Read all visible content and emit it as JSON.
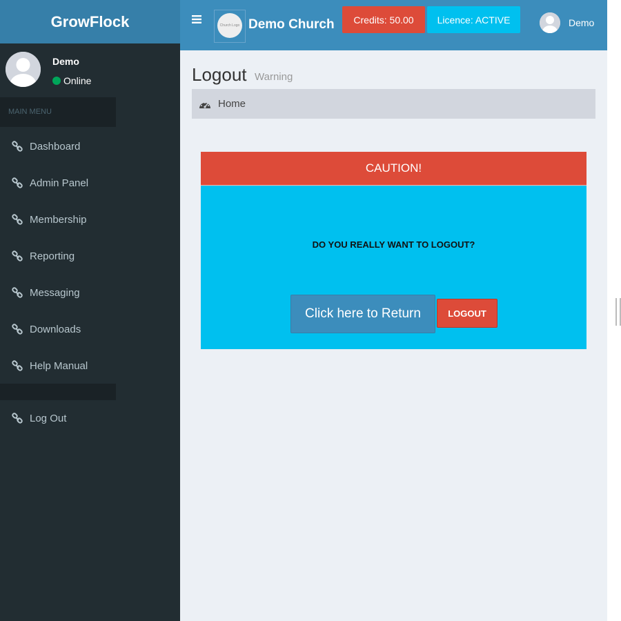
{
  "brand": {
    "name": "GrowFlock"
  },
  "user_panel": {
    "name": "Demo",
    "status": "Online",
    "status_color": "#00a65a"
  },
  "sidebar": {
    "header": "MAIN MENU",
    "items": [
      {
        "label": "Dashboard",
        "icon": "link-icon"
      },
      {
        "label": "Admin Panel",
        "icon": "link-icon"
      },
      {
        "label": "Membership",
        "icon": "link-icon"
      },
      {
        "label": "Reporting",
        "icon": "link-icon"
      },
      {
        "label": "Messaging",
        "icon": "link-icon"
      },
      {
        "label": "Downloads",
        "icon": "link-icon"
      },
      {
        "label": "Help Manual",
        "icon": "link-icon"
      }
    ],
    "logout": {
      "label": "Log Out",
      "icon": "link-icon"
    }
  },
  "navbar": {
    "menu_icon": "hamburger-icon",
    "church_logo_text": "Church Logo",
    "church_name": "Demo Church",
    "credits_label": "Credits: 50.00",
    "licence_label": "Licence: ACTIVE",
    "user_name": "Demo"
  },
  "page": {
    "title": "Logout",
    "subtitle": "Warning",
    "breadcrumb": {
      "label": "Home",
      "icon": "dashboard-icon"
    }
  },
  "caution": {
    "header": "CAUTION!",
    "question": "DO YOU REALLY WANT TO LOGOUT?",
    "return_label": "Click here to Return",
    "logout_label": "LOGOUT"
  },
  "colors": {
    "primary": "#3c8dbc",
    "danger": "#dd4b39",
    "info": "#00c0ef",
    "sidebar_bg": "#222d32"
  }
}
